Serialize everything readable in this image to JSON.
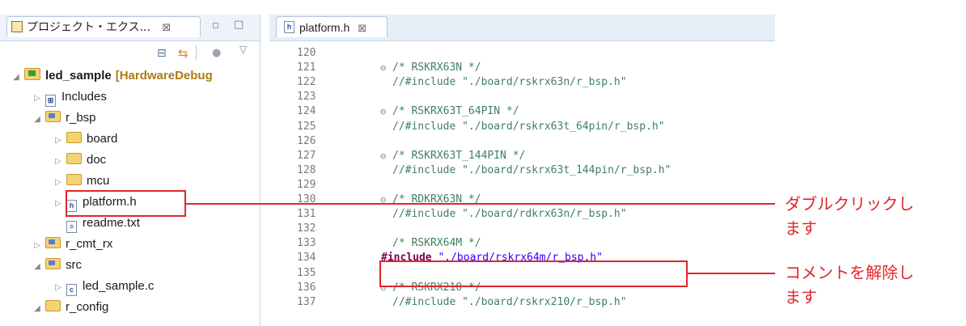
{
  "explorer": {
    "tab_title": "プロジェクト・エクス...",
    "tab_close": "⊠",
    "tree": [
      {
        "label": "led_sample",
        "suffix": "[HardwareDebug",
        "level": 0,
        "twisty": "◢",
        "kind": "project",
        "bold": true
      },
      {
        "label": "Includes",
        "level": 1,
        "twisty": "▷",
        "kind": "includes"
      },
      {
        "label": "r_bsp",
        "level": 1,
        "twisty": "◢",
        "kind": "srcfolder"
      },
      {
        "label": "board",
        "level": 2,
        "twisty": "▷",
        "kind": "folder"
      },
      {
        "label": "doc",
        "level": 2,
        "twisty": "▷",
        "kind": "folder"
      },
      {
        "label": "mcu",
        "level": 2,
        "twisty": "▷",
        "kind": "folder"
      },
      {
        "label": "platform.h",
        "level": 2,
        "twisty": "▷",
        "kind": "hfile"
      },
      {
        "label": "readme.txt",
        "level": 2,
        "twisty": "",
        "kind": "txtfile"
      },
      {
        "label": "r_cmt_rx",
        "level": 1,
        "twisty": "▷",
        "kind": "srcfolder"
      },
      {
        "label": "src",
        "level": 1,
        "twisty": "◢",
        "kind": "srcfolder"
      },
      {
        "label": "led_sample.c",
        "level": 2,
        "twisty": "▷",
        "kind": "cfile"
      },
      {
        "label": "r_config",
        "level": 1,
        "twisty": "◢",
        "kind": "folder"
      }
    ]
  },
  "editor": {
    "tab_title": "platform.h",
    "tab_close": "⊠",
    "lines": [
      {
        "no": "120",
        "fold": "",
        "text": "",
        "type": "blank"
      },
      {
        "no": "121",
        "fold": "⊖",
        "text": "/* RSKRX63N */",
        "type": "comment"
      },
      {
        "no": "122",
        "fold": "",
        "text": "//#include \"./board/rskrx63n/r_bsp.h\"",
        "type": "comment"
      },
      {
        "no": "123",
        "fold": "",
        "text": "",
        "type": "blank"
      },
      {
        "no": "124",
        "fold": "⊖",
        "text": "/* RSKRX63T_64PIN */",
        "type": "comment"
      },
      {
        "no": "125",
        "fold": "",
        "text": "//#include \"./board/rskrx63t_64pin/r_bsp.h\"",
        "type": "comment"
      },
      {
        "no": "126",
        "fold": "",
        "text": "",
        "type": "blank"
      },
      {
        "no": "127",
        "fold": "⊖",
        "text": "/* RSKRX63T_144PIN */",
        "type": "comment"
      },
      {
        "no": "128",
        "fold": "",
        "text": "//#include \"./board/rskrx63t_144pin/r_bsp.h\"",
        "type": "comment"
      },
      {
        "no": "129",
        "fold": "",
        "text": "",
        "type": "blank"
      },
      {
        "no": "130",
        "fold": "⊖",
        "text": "/* RDKRX63N */",
        "type": "comment"
      },
      {
        "no": "131",
        "fold": "",
        "text": "//#include \"./board/rdkrx63n/r_bsp.h\"",
        "type": "comment"
      },
      {
        "no": "132",
        "fold": "",
        "text": "",
        "type": "blank"
      },
      {
        "no": "133",
        "fold": "",
        "text": "/* RSKRX64M */",
        "type": "comment"
      },
      {
        "no": "134",
        "fold": "",
        "kw": "#include",
        "str": "\"./board/rskrx64m/r_bsp.h\"",
        "type": "include"
      },
      {
        "no": "135",
        "fold": "",
        "text": "",
        "type": "blank"
      },
      {
        "no": "136",
        "fold": "⊖",
        "text": "/* RSKRX210 */",
        "type": "comment"
      },
      {
        "no": "137",
        "fold": "",
        "text": "//#include \"./board/rskrx210/r_bsp.h\"",
        "type": "comment"
      }
    ]
  },
  "annotations": {
    "double_click_line1": "ダブルクリックし",
    "double_click_line2": "ます",
    "uncomment_line1": "コメントを解除し",
    "uncomment_line2": "ます"
  },
  "colors": {
    "annotation_red": "#e0262c",
    "comment_green": "#3f7f5f",
    "keyword_purple": "#7f0055",
    "string_blue": "#2a00ff"
  }
}
